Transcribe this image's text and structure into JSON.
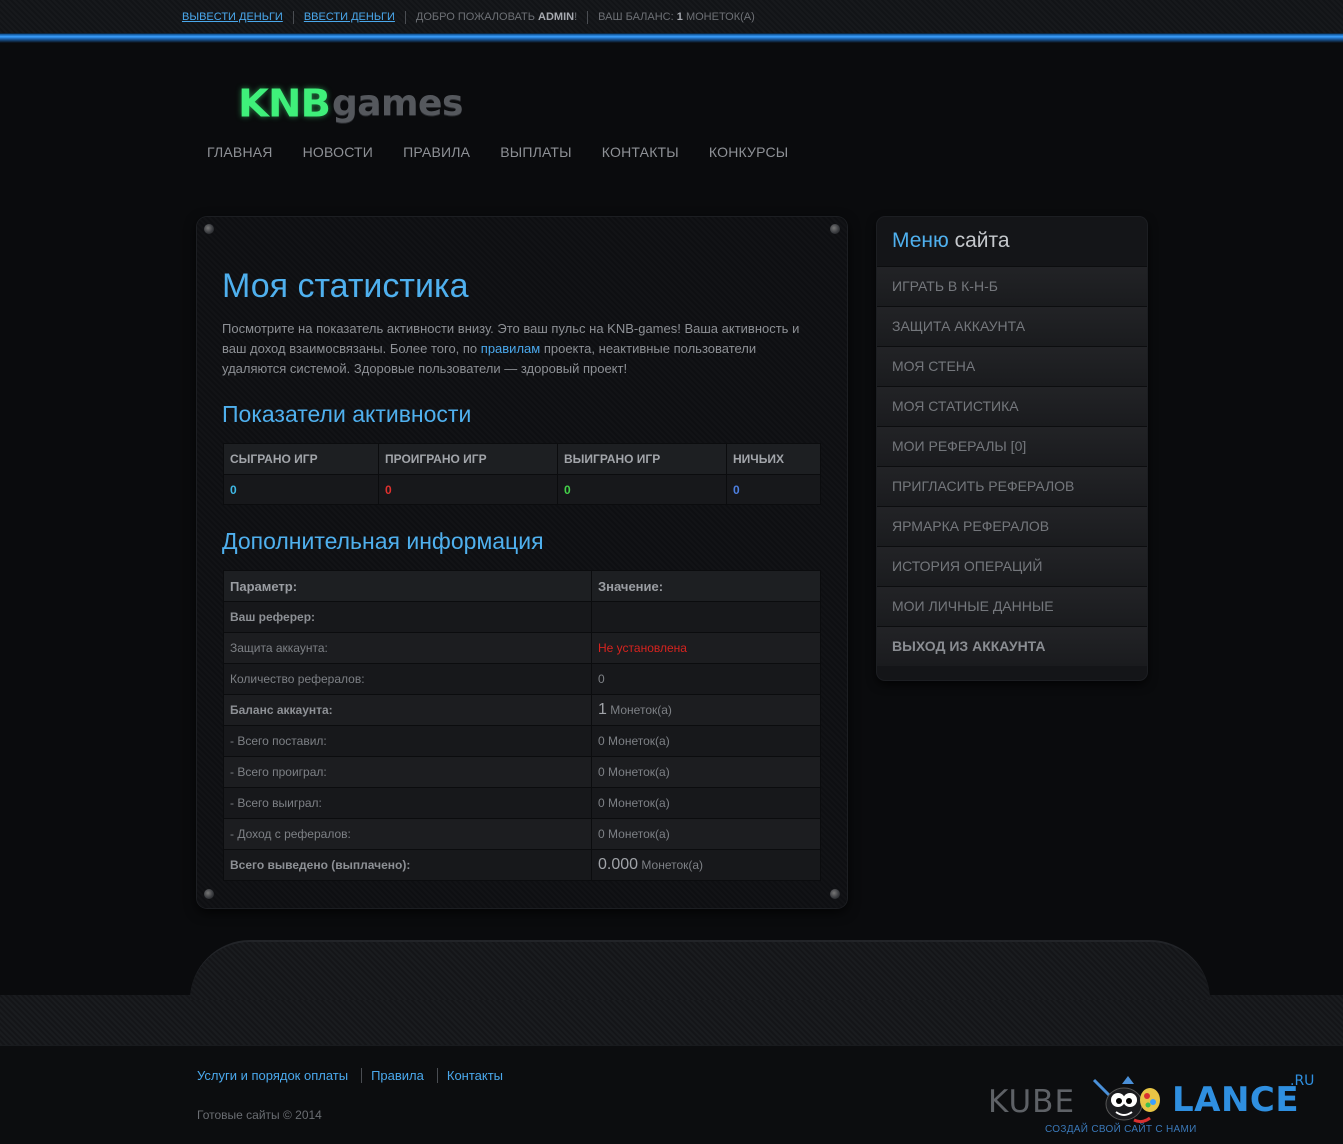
{
  "topbar": {
    "withdraw": "Вывести деньги",
    "deposit": "Ввести деньги",
    "welcome_prefix": "Добро пожаловать",
    "username": "admin",
    "welcome_suffix": "!",
    "balance_prefix": "Ваш баланс:",
    "balance_value": "1",
    "balance_unit": "Монеток(а)"
  },
  "logo": {
    "part1": "KNB",
    "part2": "games"
  },
  "nav": [
    {
      "label": "Главная"
    },
    {
      "label": "Новости"
    },
    {
      "label": "Правила"
    },
    {
      "label": "Выплаты"
    },
    {
      "label": "Контакты"
    },
    {
      "label": "Конкурсы"
    }
  ],
  "main": {
    "title": "Моя статистика",
    "intro_before": "Посмотрите на показатель активности внизу. Это ваш пульс на KNB-games! Ваша активность и ваш доход взаимосвязаны. Более того, по ",
    "intro_link": "правилам",
    "intro_after": " проекта, неактивные пользователи удаляются системой. Здоровые пользователи — здоровый проект!",
    "activity_title": "Показатели активности",
    "activity": {
      "headers": [
        "Сыграно игр",
        "Проиграно игр",
        "Выиграно игр",
        "Ничьих"
      ],
      "values": [
        "0",
        "0",
        "0",
        "0"
      ]
    },
    "extra_title": "Дополнительная информация",
    "extra": {
      "headers": [
        "Параметр:",
        "Значение:"
      ],
      "rows": [
        {
          "label": "Ваш реферер:",
          "value": "",
          "unit": ""
        },
        {
          "label": "Защита аккаунта:",
          "value": "Не установлена",
          "unit": ""
        },
        {
          "label": "Количество рефералов:",
          "value": "0",
          "unit": ""
        },
        {
          "label": "Баланс аккаунта:",
          "value": "1",
          "unit": "Монеток(а)"
        },
        {
          "label": "- Всего поставил:",
          "value": "0",
          "unit": "Монеток(а)"
        },
        {
          "label": "- Всего проиграл:",
          "value": "0",
          "unit": "Монеток(а)"
        },
        {
          "label": "- Всего выиграл:",
          "value": "0",
          "unit": "Монеток(а)"
        },
        {
          "label": "- Доход с рефералов:",
          "value": "0",
          "unit": "Монеток(а)"
        },
        {
          "label": "Всего выведено (выплачено):",
          "value": "0.000",
          "unit": "Монеток(а)"
        }
      ]
    }
  },
  "sidebar": {
    "title_a": "Меню",
    "title_b": "сайта",
    "items": [
      {
        "label": "Играть в К-Н-Б"
      },
      {
        "label": "Защита аккаунта"
      },
      {
        "label": "Моя стена"
      },
      {
        "label": "Моя статистика"
      },
      {
        "label": "Мои рефералы [0]"
      },
      {
        "label": "Пригласить рефералов"
      },
      {
        "label": "Ярмарка рефералов"
      },
      {
        "label": "История операций"
      },
      {
        "label": "Мои личные данные"
      },
      {
        "label": "Выход из аккаунта"
      }
    ]
  },
  "footer": {
    "links": [
      "Услуги и порядок оплаты",
      "Правила",
      "Контакты"
    ],
    "copyright": "Готовые сайты © 2014",
    "brand_kube": "KUBE",
    "brand_lance": "LANCE",
    "brand_ru": ".RU",
    "brand_tag": "создай свой сайт с нами"
  },
  "colors": {
    "accent": "#4fb0ee",
    "link": "#4aa8ec",
    "logo_green": "#3ff07a",
    "danger": "#e0312e",
    "success": "#44d14a"
  }
}
